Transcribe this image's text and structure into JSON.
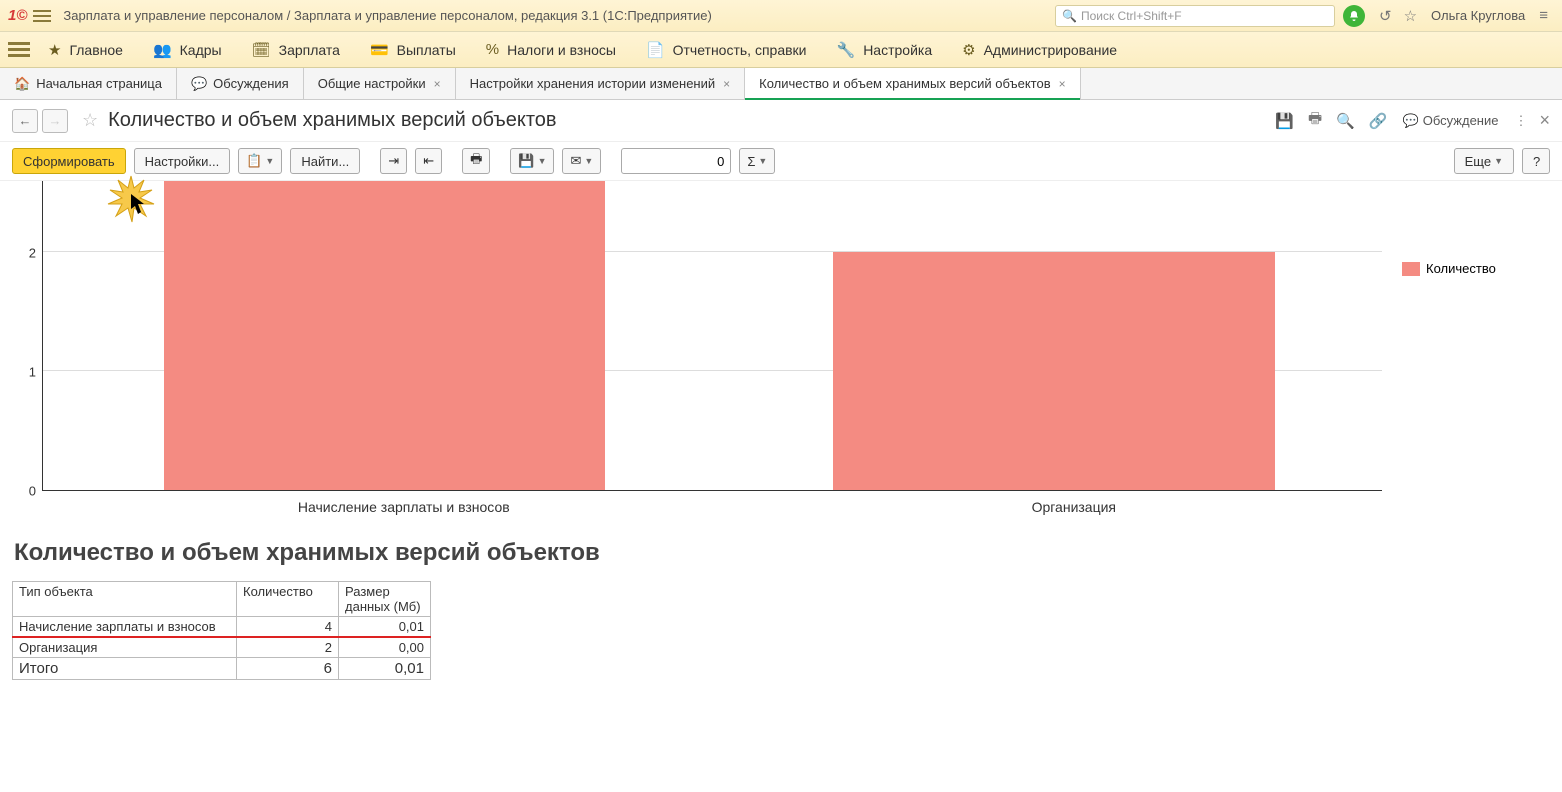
{
  "title_bar": {
    "app_title": "Зарплата и управление персоналом / Зарплата и управление персоналом, редакция 3.1  (1С:Предприятие)",
    "search_placeholder": "Поиск Ctrl+Shift+F",
    "user": "Ольга Круглова"
  },
  "main_menu": [
    {
      "icon": "star",
      "label": "Главное"
    },
    {
      "icon": "people",
      "label": "Кадры"
    },
    {
      "icon": "calc",
      "label": "Зарплата"
    },
    {
      "icon": "wallet",
      "label": "Выплаты"
    },
    {
      "icon": "percent",
      "label": "Налоги и взносы"
    },
    {
      "icon": "doc",
      "label": "Отчетность, справки"
    },
    {
      "icon": "wrench",
      "label": "Настройка"
    },
    {
      "icon": "gear",
      "label": "Администрирование"
    }
  ],
  "tabs": [
    {
      "label": "Начальная страница",
      "icon": "home",
      "closable": false
    },
    {
      "label": "Обсуждения",
      "icon": "chat",
      "closable": false
    },
    {
      "label": "Общие настройки",
      "closable": true
    },
    {
      "label": "Настройки хранения истории изменений",
      "closable": true
    },
    {
      "label": "Количество и объем хранимых версий объектов",
      "closable": true,
      "active": true
    }
  ],
  "page": {
    "title": "Количество и объем хранимых версий объектов",
    "discuss": "Обсуждение"
  },
  "toolbar": {
    "generate": "Сформировать",
    "settings": "Настройки...",
    "find": "Найти...",
    "num_value": "0",
    "more": "Еще",
    "help": "?"
  },
  "chart_data": {
    "type": "bar",
    "categories": [
      "Начисление зарплаты и взносов",
      "Организация"
    ],
    "values": [
      4,
      2
    ],
    "visible_y_ticks": [
      0,
      1,
      2
    ],
    "y_visible_max": 2.6,
    "legend": "Количество"
  },
  "report": {
    "title": "Количество и объем хранимых версий объектов",
    "columns": [
      "Тип объекта",
      "Количество",
      "Размер данных (Мб)"
    ],
    "rows": [
      {
        "type": "Начисление зарплаты и взносов",
        "count": "4",
        "size": "0,01",
        "highlight": true
      },
      {
        "type": "Организация",
        "count": "2",
        "size": "0,00"
      }
    ],
    "total": {
      "label": "Итого",
      "count": "6",
      "size": "0,01"
    }
  }
}
